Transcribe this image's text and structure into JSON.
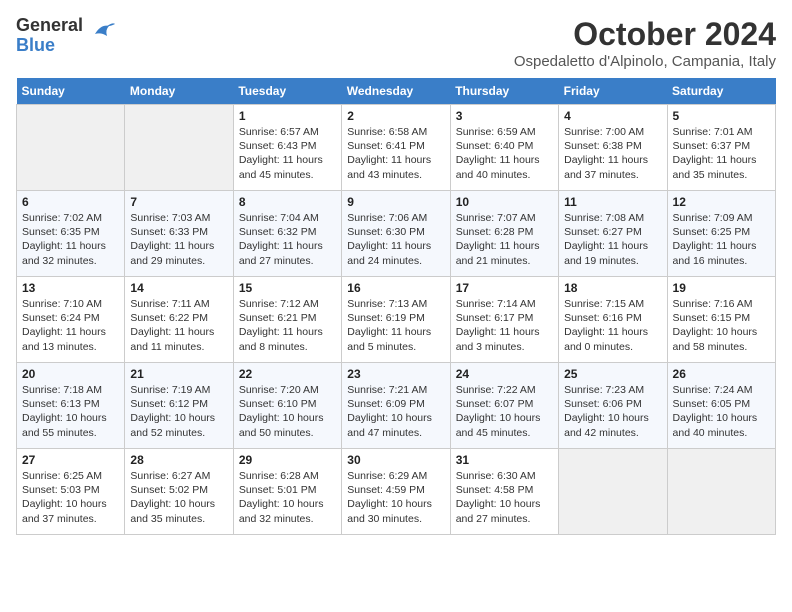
{
  "header": {
    "logo": {
      "general": "General",
      "blue": "Blue"
    },
    "month": "October 2024",
    "location": "Ospedaletto d'Alpinolo, Campania, Italy"
  },
  "weekdays": [
    "Sunday",
    "Monday",
    "Tuesday",
    "Wednesday",
    "Thursday",
    "Friday",
    "Saturday"
  ],
  "weeks": [
    [
      {
        "day": "",
        "info": ""
      },
      {
        "day": "",
        "info": ""
      },
      {
        "day": "1",
        "info": "Sunrise: 6:57 AM\nSunset: 6:43 PM\nDaylight: 11 hours and 45 minutes."
      },
      {
        "day": "2",
        "info": "Sunrise: 6:58 AM\nSunset: 6:41 PM\nDaylight: 11 hours and 43 minutes."
      },
      {
        "day": "3",
        "info": "Sunrise: 6:59 AM\nSunset: 6:40 PM\nDaylight: 11 hours and 40 minutes."
      },
      {
        "day": "4",
        "info": "Sunrise: 7:00 AM\nSunset: 6:38 PM\nDaylight: 11 hours and 37 minutes."
      },
      {
        "day": "5",
        "info": "Sunrise: 7:01 AM\nSunset: 6:37 PM\nDaylight: 11 hours and 35 minutes."
      }
    ],
    [
      {
        "day": "6",
        "info": "Sunrise: 7:02 AM\nSunset: 6:35 PM\nDaylight: 11 hours and 32 minutes."
      },
      {
        "day": "7",
        "info": "Sunrise: 7:03 AM\nSunset: 6:33 PM\nDaylight: 11 hours and 29 minutes."
      },
      {
        "day": "8",
        "info": "Sunrise: 7:04 AM\nSunset: 6:32 PM\nDaylight: 11 hours and 27 minutes."
      },
      {
        "day": "9",
        "info": "Sunrise: 7:06 AM\nSunset: 6:30 PM\nDaylight: 11 hours and 24 minutes."
      },
      {
        "day": "10",
        "info": "Sunrise: 7:07 AM\nSunset: 6:28 PM\nDaylight: 11 hours and 21 minutes."
      },
      {
        "day": "11",
        "info": "Sunrise: 7:08 AM\nSunset: 6:27 PM\nDaylight: 11 hours and 19 minutes."
      },
      {
        "day": "12",
        "info": "Sunrise: 7:09 AM\nSunset: 6:25 PM\nDaylight: 11 hours and 16 minutes."
      }
    ],
    [
      {
        "day": "13",
        "info": "Sunrise: 7:10 AM\nSunset: 6:24 PM\nDaylight: 11 hours and 13 minutes."
      },
      {
        "day": "14",
        "info": "Sunrise: 7:11 AM\nSunset: 6:22 PM\nDaylight: 11 hours and 11 minutes."
      },
      {
        "day": "15",
        "info": "Sunrise: 7:12 AM\nSunset: 6:21 PM\nDaylight: 11 hours and 8 minutes."
      },
      {
        "day": "16",
        "info": "Sunrise: 7:13 AM\nSunset: 6:19 PM\nDaylight: 11 hours and 5 minutes."
      },
      {
        "day": "17",
        "info": "Sunrise: 7:14 AM\nSunset: 6:17 PM\nDaylight: 11 hours and 3 minutes."
      },
      {
        "day": "18",
        "info": "Sunrise: 7:15 AM\nSunset: 6:16 PM\nDaylight: 11 hours and 0 minutes."
      },
      {
        "day": "19",
        "info": "Sunrise: 7:16 AM\nSunset: 6:15 PM\nDaylight: 10 hours and 58 minutes."
      }
    ],
    [
      {
        "day": "20",
        "info": "Sunrise: 7:18 AM\nSunset: 6:13 PM\nDaylight: 10 hours and 55 minutes."
      },
      {
        "day": "21",
        "info": "Sunrise: 7:19 AM\nSunset: 6:12 PM\nDaylight: 10 hours and 52 minutes."
      },
      {
        "day": "22",
        "info": "Sunrise: 7:20 AM\nSunset: 6:10 PM\nDaylight: 10 hours and 50 minutes."
      },
      {
        "day": "23",
        "info": "Sunrise: 7:21 AM\nSunset: 6:09 PM\nDaylight: 10 hours and 47 minutes."
      },
      {
        "day": "24",
        "info": "Sunrise: 7:22 AM\nSunset: 6:07 PM\nDaylight: 10 hours and 45 minutes."
      },
      {
        "day": "25",
        "info": "Sunrise: 7:23 AM\nSunset: 6:06 PM\nDaylight: 10 hours and 42 minutes."
      },
      {
        "day": "26",
        "info": "Sunrise: 7:24 AM\nSunset: 6:05 PM\nDaylight: 10 hours and 40 minutes."
      }
    ],
    [
      {
        "day": "27",
        "info": "Sunrise: 6:25 AM\nSunset: 5:03 PM\nDaylight: 10 hours and 37 minutes."
      },
      {
        "day": "28",
        "info": "Sunrise: 6:27 AM\nSunset: 5:02 PM\nDaylight: 10 hours and 35 minutes."
      },
      {
        "day": "29",
        "info": "Sunrise: 6:28 AM\nSunset: 5:01 PM\nDaylight: 10 hours and 32 minutes."
      },
      {
        "day": "30",
        "info": "Sunrise: 6:29 AM\nSunset: 4:59 PM\nDaylight: 10 hours and 30 minutes."
      },
      {
        "day": "31",
        "info": "Sunrise: 6:30 AM\nSunset: 4:58 PM\nDaylight: 10 hours and 27 minutes."
      },
      {
        "day": "",
        "info": ""
      },
      {
        "day": "",
        "info": ""
      }
    ]
  ]
}
